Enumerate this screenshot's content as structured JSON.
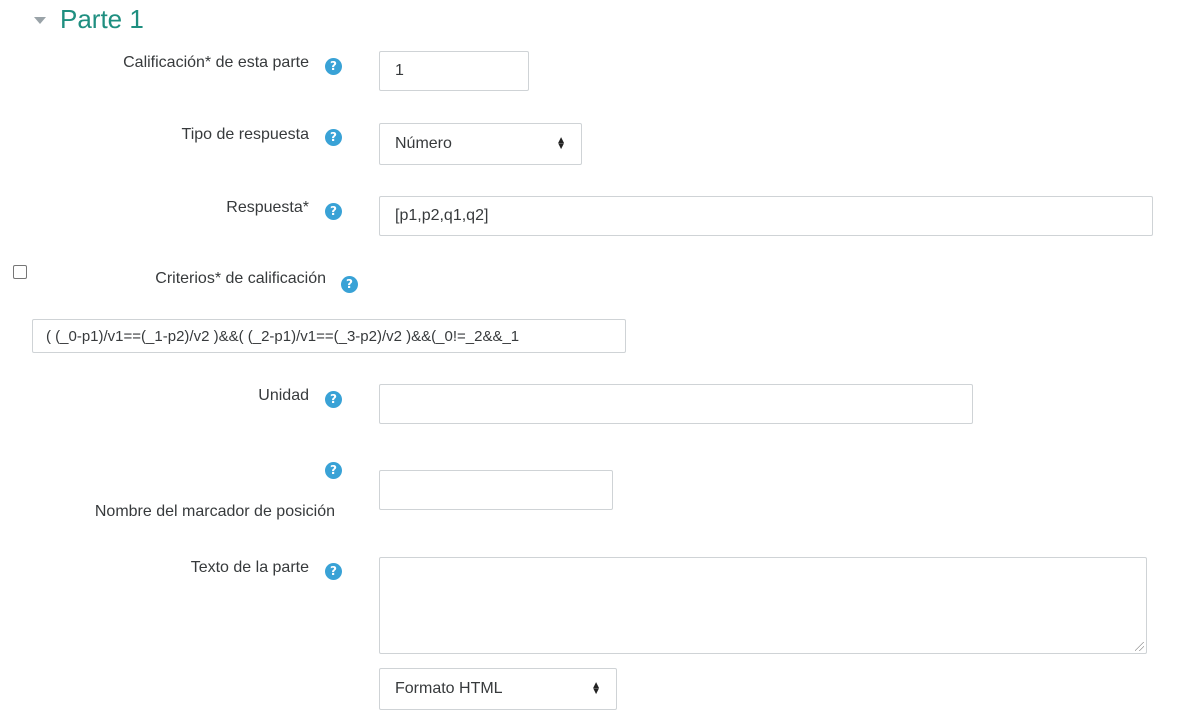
{
  "section": {
    "title": "Parte 1"
  },
  "fields": {
    "grade": {
      "label": "Calificación* de esta parte",
      "value": "1"
    },
    "response_type": {
      "label": "Tipo de respuesta",
      "selected": "Número"
    },
    "answer": {
      "label": "Respuesta*",
      "value": "[p1,p2,q1,q2]"
    },
    "criteria": {
      "label": "Criterios* de calificación",
      "value": "( (_0-p1)/v1==(_1-p2)/v2 )&&( (_2-p1)/v1==(_3-p2)/v2 )&&(_0!=_2&&_1"
    },
    "unit": {
      "label": "Unidad",
      "value": ""
    },
    "placeholder_name": {
      "label": "Nombre del marcador de posición",
      "value": ""
    },
    "part_text": {
      "label": "Texto de la parte",
      "value": "",
      "format": "Formato HTML"
    }
  },
  "icons": {
    "help": "question-circle-icon",
    "caret": "caret-down-icon",
    "select_arrows": "up-down-arrows-icon"
  },
  "colors": {
    "title": "#1f8f80",
    "help": "#39a2d6",
    "border": "#cfd3d6"
  }
}
